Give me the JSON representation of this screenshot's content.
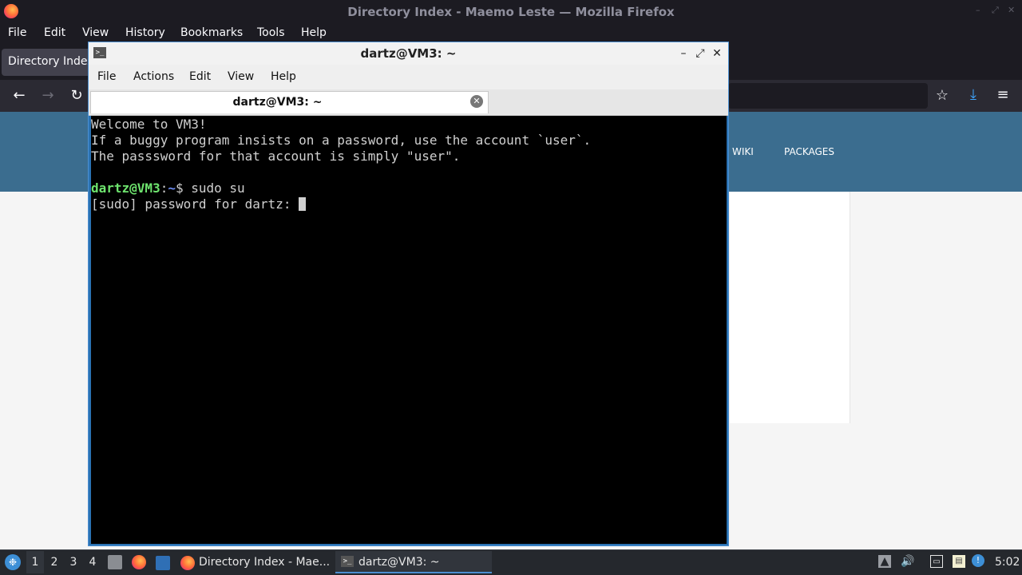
{
  "firefox": {
    "window_title": "Directory Index - Maemo Leste — Mozilla Firefox",
    "menu": [
      "File",
      "Edit",
      "View",
      "History",
      "Bookmarks",
      "Tools",
      "Help"
    ],
    "tab_title": "Directory Index",
    "site_nav": [
      "WIKI",
      "PACKAGES"
    ]
  },
  "terminal": {
    "window_title": "dartz@VM3: ~",
    "menu": [
      "File",
      "Actions",
      "Edit",
      "View",
      "Help"
    ],
    "tab_title": "dartz@VM3: ~",
    "lines": [
      "Welcome to VM3!",
      "If a buggy program insists on a password, use the account `user`.",
      "The passsword for that account is simply \"user\"."
    ],
    "prompt_user": "dartz@VM3",
    "prompt_sep": ":",
    "prompt_path": "~",
    "prompt_end": "$ ",
    "command": "sudo su",
    "sudo_prompt": "[sudo] password for dartz: "
  },
  "taskbar": {
    "workspaces": [
      "1",
      "2",
      "3",
      "4"
    ],
    "active_workspace": "1",
    "tasks": [
      "Directory Index - Mae...",
      "dartz@VM3: ~"
    ],
    "clock": "5:02",
    "colors": {
      "bg": "#25282d",
      "accent": "#4c8fd1"
    }
  }
}
